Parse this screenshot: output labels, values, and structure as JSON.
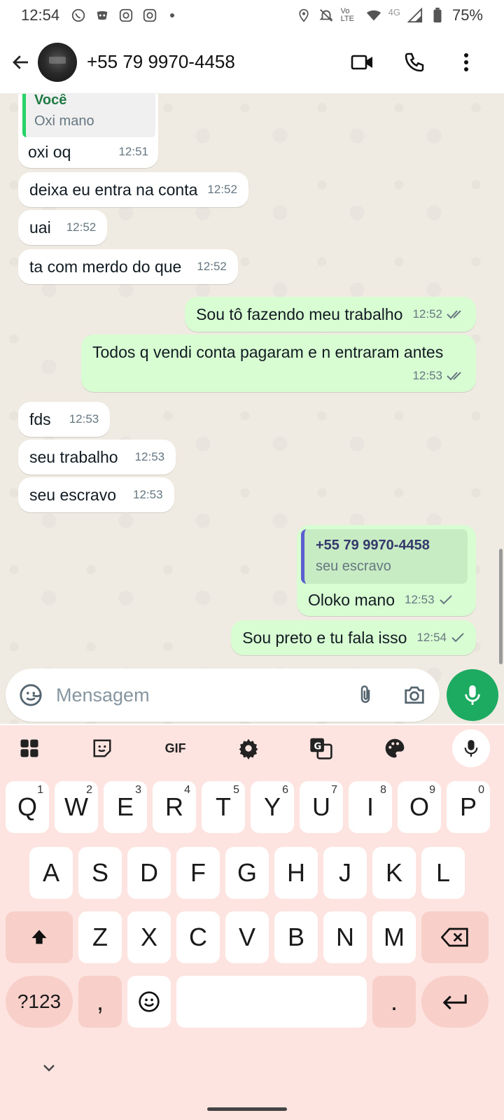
{
  "status_bar": {
    "time": "12:54",
    "network": "4G",
    "battery": "75%",
    "volte": "Vo LTE"
  },
  "header": {
    "contact_name": "+55 79 9970-4458"
  },
  "messages": [
    {
      "dir": "in",
      "quote_author": "Você",
      "quote_text": "Oxi mano",
      "text": "oxi oq",
      "time": "12:51"
    },
    {
      "dir": "in",
      "text": "deixa eu entra na conta",
      "time": "12:52"
    },
    {
      "dir": "in",
      "text": "uai",
      "time": "12:52"
    },
    {
      "dir": "in",
      "text": "ta com merdo do que",
      "time": "12:52"
    },
    {
      "dir": "out",
      "text": "Sou tô fazendo meu trabalho",
      "time": "12:52",
      "status": "read"
    },
    {
      "dir": "out",
      "text": "Todos q vendi conta pagaram e n entraram antes",
      "time": "12:53",
      "status": "read"
    },
    {
      "dir": "in",
      "text": "fds",
      "time": "12:53"
    },
    {
      "dir": "in",
      "text": "seu trabalho",
      "time": "12:53"
    },
    {
      "dir": "in",
      "text": "seu escravo",
      "time": "12:53"
    },
    {
      "dir": "out",
      "quote_author": "+55 79 9970-4458",
      "quote_text": "seu escravo",
      "text": "Oloko mano",
      "time": "12:53",
      "status": "sent"
    },
    {
      "dir": "out",
      "text": "Sou preto e tu fala isso",
      "time": "12:54",
      "status": "sent"
    }
  ],
  "composer": {
    "placeholder": "Mensagem"
  },
  "keyboard": {
    "toolbar": [
      "apps-icon",
      "sticker-icon",
      "GIF",
      "settings-icon",
      "translate-icon",
      "palette-icon",
      "mic-icon"
    ],
    "row1": [
      {
        "k": "Q",
        "h": "1"
      },
      {
        "k": "W",
        "h": "2"
      },
      {
        "k": "E",
        "h": "3"
      },
      {
        "k": "R",
        "h": "4"
      },
      {
        "k": "T",
        "h": "5"
      },
      {
        "k": "Y",
        "h": "6"
      },
      {
        "k": "U",
        "h": "7"
      },
      {
        "k": "I",
        "h": "8"
      },
      {
        "k": "O",
        "h": "9"
      },
      {
        "k": "P",
        "h": "0"
      }
    ],
    "row2": [
      "A",
      "S",
      "D",
      "F",
      "G",
      "H",
      "J",
      "K",
      "L"
    ],
    "row3": [
      "Z",
      "X",
      "C",
      "V",
      "B",
      "N",
      "M"
    ],
    "symbols_label": "?123",
    "comma": ",",
    "period": "."
  },
  "colors": {
    "accent": "#1daa61",
    "outgoing_bubble": "#d9fdd3",
    "chat_bg": "#efeae2",
    "keyboard_bg": "#fde4e1"
  }
}
